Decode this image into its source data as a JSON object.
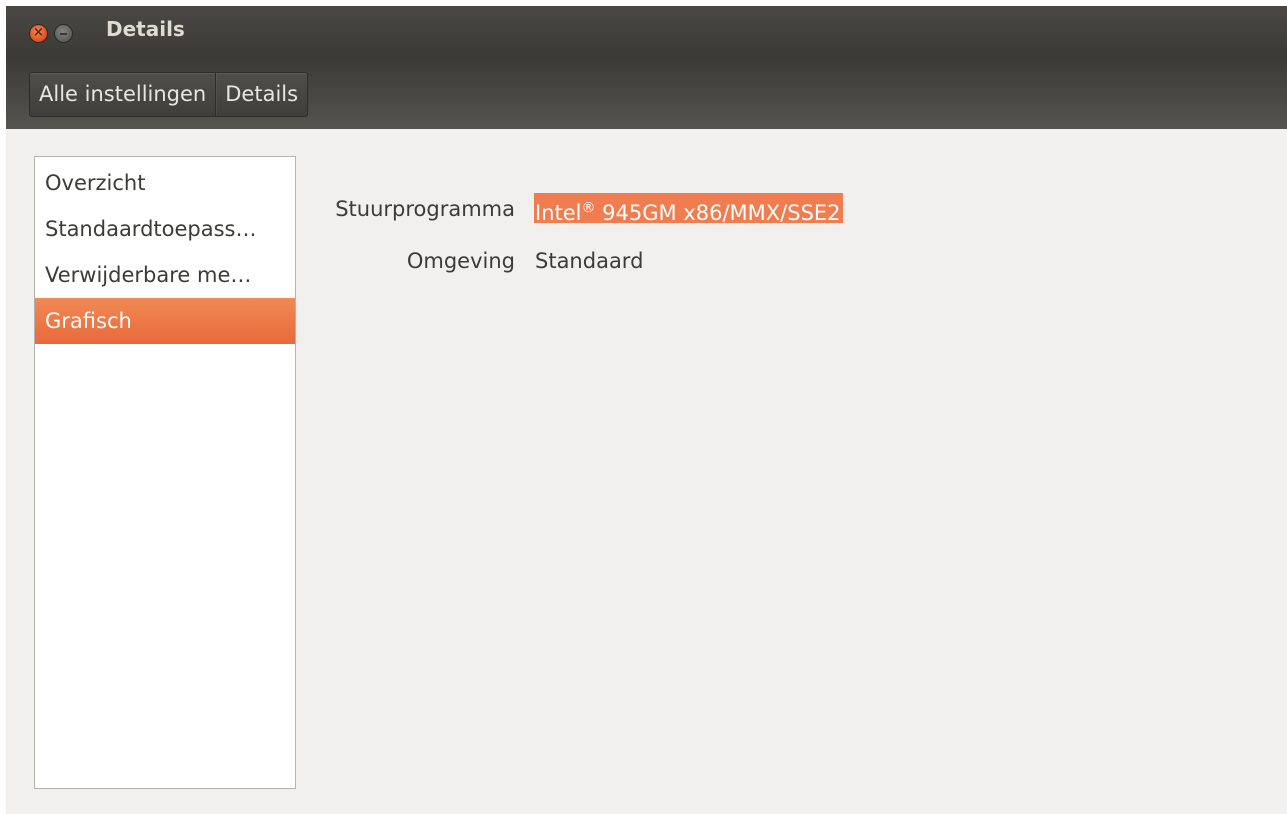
{
  "window": {
    "title": "Details"
  },
  "breadcrumb": {
    "items": [
      "Alle instellingen",
      "Details"
    ]
  },
  "sidebar": {
    "items": [
      {
        "label": "Overzicht"
      },
      {
        "label": "Standaardtoepass…"
      },
      {
        "label": "Verwijderbare me…"
      },
      {
        "label": "Grafisch"
      }
    ],
    "selected": "Grafisch"
  },
  "graphics": {
    "driver_label": "Stuurprogramma",
    "driver_value_brand": "Intel",
    "driver_value_mark": "®",
    "driver_value_rest": " 945GM x86/MMX/SSE2",
    "environment_label": "Omgeving",
    "environment_value": "Standaard"
  },
  "colors": {
    "accent": "#ef7d4f",
    "titlebar": "#3c3b37",
    "background": "#f1f0ee"
  }
}
